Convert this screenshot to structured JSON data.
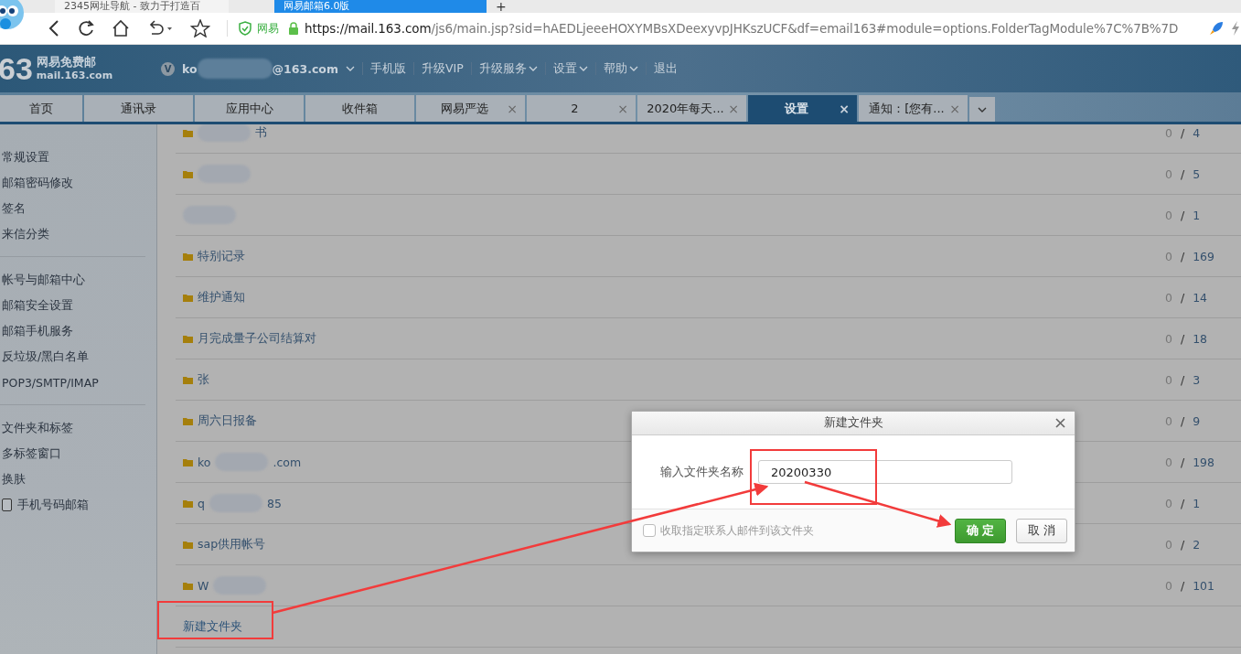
{
  "browser": {
    "tabs": [
      {
        "title": "2345网址导航 - 致力于打造百",
        "selected": false
      },
      {
        "title": "网易邮箱6.0版",
        "selected": true
      }
    ],
    "new_tab": "+",
    "security_label": "网易",
    "url_domain": "https://mail.163.com",
    "url_rest": "/js6/main.jsp?sid=hAEDLjeeeHOXYMBsXDeexyvpJHKszUCF&df=email163#module=options.FolderTagModule%7C%7B%7D"
  },
  "header": {
    "logo_number": "63",
    "logo_title": "网易免费邮",
    "logo_domain": "mail.163.com",
    "user_badge": "V",
    "user_prefix": "ko",
    "user_suffix": "@163.com",
    "links": [
      {
        "label": "手机版",
        "dropdown": false
      },
      {
        "label": "升级VIP",
        "dropdown": false
      },
      {
        "label": "升级服务",
        "dropdown": true
      },
      {
        "label": "设置",
        "dropdown": true
      },
      {
        "label": "帮助",
        "dropdown": true
      },
      {
        "label": "退出",
        "dropdown": false
      }
    ]
  },
  "tabs": [
    {
      "label": "首页",
      "selected": false
    },
    {
      "label": "通讯录",
      "selected": false
    },
    {
      "label": "应用中心",
      "selected": false
    },
    {
      "label": "收件箱",
      "selected": false
    },
    {
      "label": "网易严选",
      "close": "×",
      "selected": false
    },
    {
      "label": "2",
      "close": "×",
      "selected": false
    },
    {
      "label": "2020年每天...",
      "close": "×",
      "selected": false
    },
    {
      "label": "设置",
      "close": "×",
      "selected": true
    },
    {
      "label": "通知：[您有...",
      "close": "×",
      "selected": false
    }
  ],
  "sidebar": {
    "groups": [
      {
        "items": [
          {
            "label": "常规设置"
          },
          {
            "label": "邮箱密码修改"
          },
          {
            "label": "签名"
          },
          {
            "label": "来信分类"
          }
        ]
      },
      {
        "items": [
          {
            "label": "帐号与邮箱中心"
          },
          {
            "label": "邮箱安全设置"
          },
          {
            "label": "邮箱手机服务"
          },
          {
            "label": "反垃圾/黑白名单"
          },
          {
            "label": "POP3/SMTP/IMAP"
          }
        ]
      },
      {
        "items": [
          {
            "label": "文件夹和标签"
          },
          {
            "label": "多标签窗口"
          },
          {
            "label": "换肤"
          },
          {
            "label": "手机号码邮箱",
            "kind": "checkbox",
            "checked": false
          }
        ]
      }
    ]
  },
  "folders": [
    {
      "suffix": "书",
      "redacted": true,
      "folder_icon": true,
      "unread": "0",
      "separator": "/",
      "total": "4"
    },
    {
      "redacted": true,
      "folder_icon": true,
      "unread": "0",
      "separator": "/",
      "total": "5"
    },
    {
      "redacted": true,
      "folder_icon": false,
      "unread": "0",
      "separator": "/",
      "total": "1"
    },
    {
      "prefix": "特别记录",
      "redacted": false,
      "folder_icon": true,
      "unread": "0",
      "separator": "/",
      "total": "169"
    },
    {
      "prefix": "维护通知",
      "redacted": false,
      "folder_icon": true,
      "unread": "0",
      "separator": "/",
      "total": "14"
    },
    {
      "prefix": "月完成量子公司结算对",
      "redacted": false,
      "folder_icon": true,
      "unread": "0",
      "separator": "/",
      "total": "18"
    },
    {
      "prefix": "张",
      "redacted": false,
      "folder_icon": true,
      "unread": "0",
      "separator": "/",
      "total": "3"
    },
    {
      "prefix": "周六日报备",
      "redacted": false,
      "folder_icon": true,
      "unread": "0",
      "separator": "/",
      "total": "9"
    },
    {
      "prefix": "ko",
      "suffix": ".com",
      "redacted": true,
      "folder_icon": true,
      "unread": "0",
      "separator": "/",
      "total": "198"
    },
    {
      "prefix": "q",
      "suffix": "85",
      "redacted": true,
      "folder_icon": true,
      "unread": "0",
      "separator": "/",
      "total": "1"
    },
    {
      "prefix": "sap供用帐号",
      "redacted": false,
      "folder_icon": true,
      "unread": "0",
      "separator": "/",
      "total": "2"
    },
    {
      "prefix": "W",
      "redacted": true,
      "folder_icon": true,
      "unread": "0",
      "separator": "/",
      "total": "101"
    }
  ],
  "new_folder_link": "新建文件夹",
  "dialog": {
    "title": "新建文件夹",
    "field_label": "输入文件夹名称",
    "field_value": "20200330",
    "option_label": "收取指定联系人邮件到该文件夹",
    "option_checked": false,
    "ok": "确 定",
    "cancel": "取 消"
  }
}
